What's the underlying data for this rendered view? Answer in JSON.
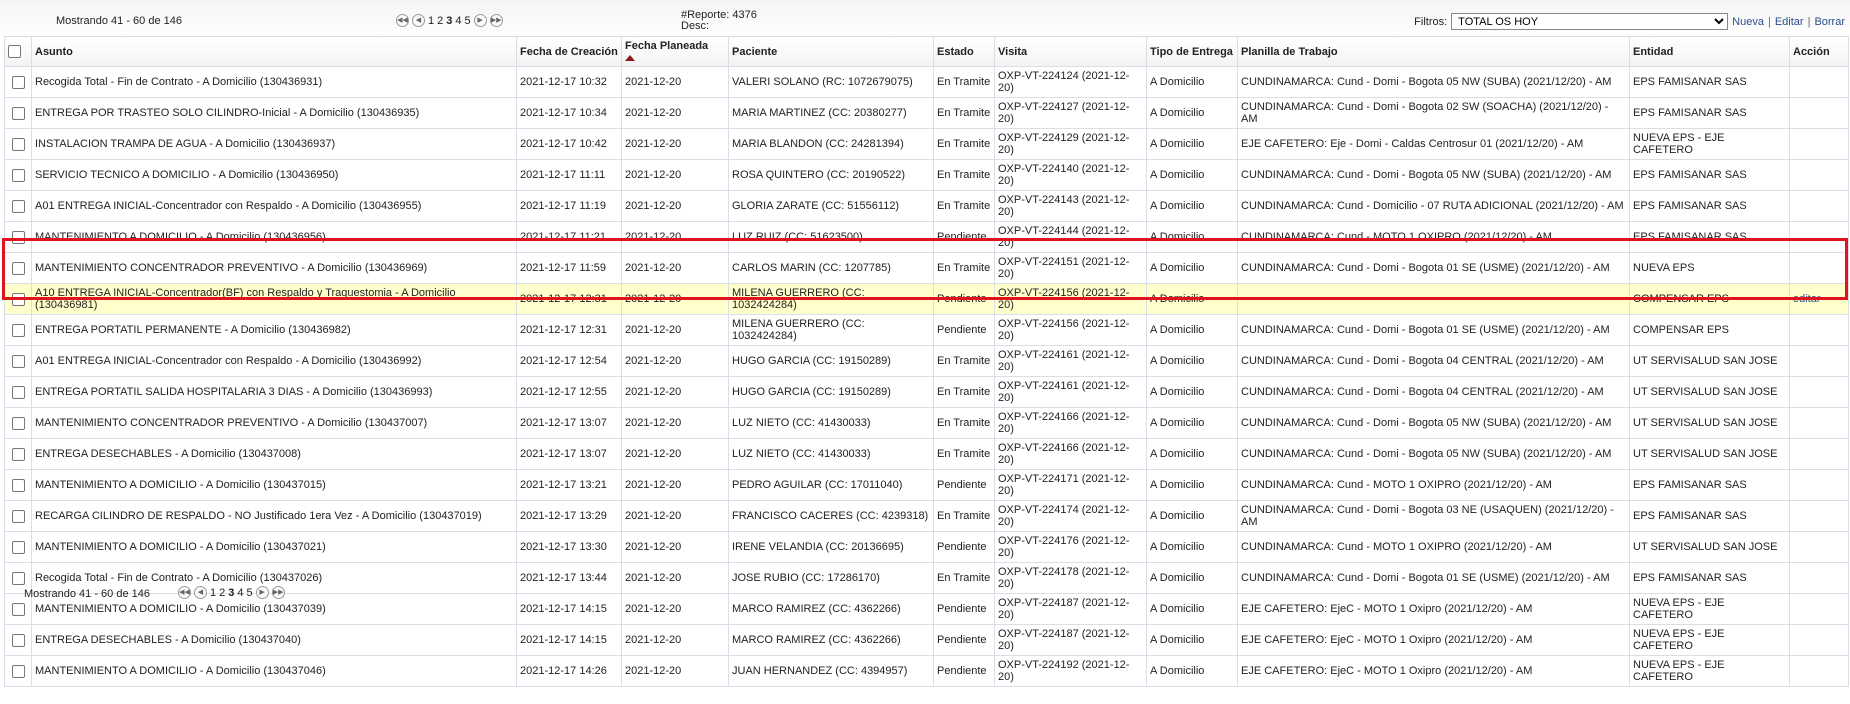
{
  "pager_top": {
    "showing": "Mostrando 41 - 60 de 146",
    "pages": [
      "1",
      "2",
      "3",
      "4",
      "5"
    ]
  },
  "report": {
    "number": "#Reporte: 4376",
    "desc": "Desc:"
  },
  "filters": {
    "label": "Filtros:",
    "selected": "TOTAL OS HOY",
    "links": [
      "Nueva",
      "Editar",
      "Borrar"
    ]
  },
  "table": {
    "headers": {
      "asunto": "Asunto",
      "fecha_creacion": "Fecha de Creación",
      "fecha_planeada": "Fecha Planeada",
      "paciente": "Paciente",
      "estado": "Estado",
      "visita": "Visita",
      "tipo_entrega": "Tipo de Entrega",
      "planilla": "Planilla de Trabajo",
      "entidad": "Entidad",
      "accion": "Acción"
    },
    "rows": [
      {
        "asunto": "Recogida Total - Fin de Contrato - A Domicilio (130436931)",
        "creacion": "2021-12-17 10:32",
        "planeada": "2021-12-20",
        "paciente": "VALERI SOLANO (RC: 1072679075)",
        "estado": "En Tramite",
        "visita": "OXP-VT-224124 (2021-12-20)",
        "tipo": "A Domicilio",
        "planilla": "CUNDINAMARCA: Cund - Domi - Bogota 05 NW (SUBA) (2021/12/20) - AM",
        "entidad": "EPS FAMISANAR SAS",
        "accion": ""
      },
      {
        "asunto": "ENTREGA POR TRASTEO SOLO CILINDRO-Inicial - A Domicilio (130436935)",
        "creacion": "2021-12-17 10:34",
        "planeada": "2021-12-20",
        "paciente": "MARIA MARTINEZ (CC: 20380277)",
        "estado": "En Tramite",
        "visita": "OXP-VT-224127 (2021-12-20)",
        "tipo": "A Domicilio",
        "planilla": "CUNDINAMARCA: Cund - Domi - Bogota 02 SW (SOACHA) (2021/12/20) - AM",
        "entidad": "EPS FAMISANAR SAS",
        "accion": ""
      },
      {
        "asunto": "INSTALACION TRAMPA DE AGUA - A Domicilio (130436937)",
        "creacion": "2021-12-17 10:42",
        "planeada": "2021-12-20",
        "paciente": "MARIA BLANDON (CC: 24281394)",
        "estado": "En Tramite",
        "visita": "OXP-VT-224129 (2021-12-20)",
        "tipo": "A Domicilio",
        "planilla": "EJE CAFETERO: Eje - Domi - Caldas Centrosur 01 (2021/12/20) - AM",
        "entidad": "NUEVA EPS - EJE CAFETERO",
        "accion": ""
      },
      {
        "asunto": "SERVICIO TECNICO A DOMICILIO - A Domicilio (130436950)",
        "creacion": "2021-12-17 11:11",
        "planeada": "2021-12-20",
        "paciente": "ROSA QUINTERO (CC: 20190522)",
        "estado": "En Tramite",
        "visita": "OXP-VT-224140 (2021-12-20)",
        "tipo": "A Domicilio",
        "planilla": "CUNDINAMARCA: Cund - Domi - Bogota 05 NW (SUBA) (2021/12/20) - AM",
        "entidad": "EPS FAMISANAR SAS",
        "accion": ""
      },
      {
        "asunto": "A01 ENTREGA INICIAL-Concentrador con Respaldo - A Domicilio (130436955)",
        "creacion": "2021-12-17 11:19",
        "planeada": "2021-12-20",
        "paciente": "GLORIA ZARATE (CC: 51556112)",
        "estado": "En Tramite",
        "visita": "OXP-VT-224143 (2021-12-20)",
        "tipo": "A Domicilio",
        "planilla": "CUNDINAMARCA: Cund - Domicilio - 07 RUTA ADICIONAL (2021/12/20) - AM",
        "entidad": "EPS FAMISANAR SAS",
        "accion": ""
      },
      {
        "asunto": "MANTENIMIENTO A DOMICILIO - A Domicilio (130436956)",
        "creacion": "2021-12-17 11:21",
        "planeada": "2021-12-20",
        "paciente": "LUZ RUIZ (CC: 51623500)",
        "estado": "Pendiente",
        "visita": "OXP-VT-224144 (2021-12-20)",
        "tipo": "A Domicilio",
        "planilla": "CUNDINAMARCA: Cund - MOTO 1 OXIPRO (2021/12/20) - AM",
        "entidad": "EPS FAMISANAR SAS",
        "accion": ""
      },
      {
        "asunto": "MANTENIMIENTO CONCENTRADOR PREVENTIVO - A Domicilio (130436969)",
        "creacion": "2021-12-17 11:59",
        "planeada": "2021-12-20",
        "paciente": "CARLOS MARIN (CC: 1207785)",
        "estado": "En Tramite",
        "visita": "OXP-VT-224151 (2021-12-20)",
        "tipo": "A Domicilio",
        "planilla": "CUNDINAMARCA: Cund - Domi - Bogota 01 SE (USME) (2021/12/20) - AM",
        "entidad": "NUEVA EPS",
        "accion": ""
      },
      {
        "asunto": "A10 ENTREGA INICIAL-Concentrador(BF) con Respaldo y Traquestomia - A Domicilio (130436981)",
        "creacion": "2021-12-17 12:31",
        "planeada": "2021-12-20",
        "paciente": "MILENA GUERRERO (CC: 1032424284)",
        "estado": "Pendiente",
        "visita": "OXP-VT-224156 (2021-12-20)",
        "tipo": "A Domicilio",
        "planilla": "",
        "entidad": "COMPENSAR EPS",
        "accion": "editar",
        "highlight": true
      },
      {
        "asunto": "ENTREGA PORTATIL PERMANENTE - A Domicilio (130436982)",
        "creacion": "2021-12-17 12:31",
        "planeada": "2021-12-20",
        "paciente": "MILENA GUERRERO (CC: 1032424284)",
        "estado": "Pendiente",
        "visita": "OXP-VT-224156 (2021-12-20)",
        "tipo": "A Domicilio",
        "planilla": "CUNDINAMARCA: Cund - Domi - Bogota 01 SE (USME) (2021/12/20) - AM",
        "entidad": "COMPENSAR EPS",
        "accion": ""
      },
      {
        "asunto": "A01 ENTREGA INICIAL-Concentrador con Respaldo - A Domicilio (130436992)",
        "creacion": "2021-12-17 12:54",
        "planeada": "2021-12-20",
        "paciente": "HUGO GARCIA (CC: 19150289)",
        "estado": "En Tramite",
        "visita": "OXP-VT-224161 (2021-12-20)",
        "tipo": "A Domicilio",
        "planilla": "CUNDINAMARCA: Cund - Domi - Bogota 04 CENTRAL (2021/12/20) - AM",
        "entidad": "UT SERVISALUD SAN JOSE",
        "accion": ""
      },
      {
        "asunto": "ENTREGA PORTATIL SALIDA HOSPITALARIA 3 DIAS - A Domicilio (130436993)",
        "creacion": "2021-12-17 12:55",
        "planeada": "2021-12-20",
        "paciente": "HUGO GARCIA (CC: 19150289)",
        "estado": "En Tramite",
        "visita": "OXP-VT-224161 (2021-12-20)",
        "tipo": "A Domicilio",
        "planilla": "CUNDINAMARCA: Cund - Domi - Bogota 04 CENTRAL (2021/12/20) - AM",
        "entidad": "UT SERVISALUD SAN JOSE",
        "accion": ""
      },
      {
        "asunto": "MANTENIMIENTO CONCENTRADOR PREVENTIVO - A Domicilio (130437007)",
        "creacion": "2021-12-17 13:07",
        "planeada": "2021-12-20",
        "paciente": "LUZ NIETO (CC: 41430033)",
        "estado": "En Tramite",
        "visita": "OXP-VT-224166 (2021-12-20)",
        "tipo": "A Domicilio",
        "planilla": "CUNDINAMARCA: Cund - Domi - Bogota 05 NW (SUBA) (2021/12/20) - AM",
        "entidad": "UT SERVISALUD SAN JOSE",
        "accion": ""
      },
      {
        "asunto": "ENTREGA DESECHABLES - A Domicilio (130437008)",
        "creacion": "2021-12-17 13:07",
        "planeada": "2021-12-20",
        "paciente": "LUZ NIETO (CC: 41430033)",
        "estado": "En Tramite",
        "visita": "OXP-VT-224166 (2021-12-20)",
        "tipo": "A Domicilio",
        "planilla": "CUNDINAMARCA: Cund - Domi - Bogota 05 NW (SUBA) (2021/12/20) - AM",
        "entidad": "UT SERVISALUD SAN JOSE",
        "accion": ""
      },
      {
        "asunto": "MANTENIMIENTO A DOMICILIO - A Domicilio (130437015)",
        "creacion": "2021-12-17 13:21",
        "planeada": "2021-12-20",
        "paciente": "PEDRO AGUILAR (CC: 17011040)",
        "estado": "Pendiente",
        "visita": "OXP-VT-224171 (2021-12-20)",
        "tipo": "A Domicilio",
        "planilla": "CUNDINAMARCA: Cund - MOTO 1 OXIPRO (2021/12/20) - AM",
        "entidad": "EPS FAMISANAR SAS",
        "accion": ""
      },
      {
        "asunto": "RECARGA CILINDRO DE RESPALDO - NO Justificado 1era Vez - A Domicilio (130437019)",
        "creacion": "2021-12-17 13:29",
        "planeada": "2021-12-20",
        "paciente": "FRANCISCO CACERES (CC: 4239318)",
        "estado": "En Tramite",
        "visita": "OXP-VT-224174 (2021-12-20)",
        "tipo": "A Domicilio",
        "planilla": "CUNDINAMARCA: Cund - Domi - Bogota 03 NE (USAQUEN) (2021/12/20) - AM",
        "entidad": "EPS FAMISANAR SAS",
        "accion": ""
      },
      {
        "asunto": "MANTENIMIENTO A DOMICILIO - A Domicilio (130437021)",
        "creacion": "2021-12-17 13:30",
        "planeada": "2021-12-20",
        "paciente": "IRENE VELANDIA (CC: 20136695)",
        "estado": "Pendiente",
        "visita": "OXP-VT-224176 (2021-12-20)",
        "tipo": "A Domicilio",
        "planilla": "CUNDINAMARCA: Cund - MOTO 1 OXIPRO (2021/12/20) - AM",
        "entidad": "UT SERVISALUD SAN JOSE",
        "accion": ""
      },
      {
        "asunto": "Recogida Total - Fin de Contrato - A Domicilio (130437026)",
        "creacion": "2021-12-17 13:44",
        "planeada": "2021-12-20",
        "paciente": "JOSE RUBIO (CC: 17286170)",
        "estado": "En Tramite",
        "visita": "OXP-VT-224178 (2021-12-20)",
        "tipo": "A Domicilio",
        "planilla": "CUNDINAMARCA: Cund - Domi - Bogota 01 SE (USME) (2021/12/20) - AM",
        "entidad": "EPS FAMISANAR SAS",
        "accion": ""
      },
      {
        "asunto": "MANTENIMIENTO A DOMICILIO - A Domicilio (130437039)",
        "creacion": "2021-12-17 14:15",
        "planeada": "2021-12-20",
        "paciente": "MARCO RAMIREZ (CC: 4362266)",
        "estado": "Pendiente",
        "visita": "OXP-VT-224187 (2021-12-20)",
        "tipo": "A Domicilio",
        "planilla": "EJE CAFETERO: EjeC - MOTO 1 Oxipro (2021/12/20) - AM",
        "entidad": "NUEVA EPS - EJE CAFETERO",
        "accion": ""
      },
      {
        "asunto": "ENTREGA DESECHABLES - A Domicilio (130437040)",
        "creacion": "2021-12-17 14:15",
        "planeada": "2021-12-20",
        "paciente": "MARCO RAMIREZ (CC: 4362266)",
        "estado": "Pendiente",
        "visita": "OXP-VT-224187 (2021-12-20)",
        "tipo": "A Domicilio",
        "planilla": "EJE CAFETERO: EjeC - MOTO 1 Oxipro (2021/12/20) - AM",
        "entidad": "NUEVA EPS - EJE CAFETERO",
        "accion": ""
      },
      {
        "asunto": "MANTENIMIENTO A DOMICILIO - A Domicilio (130437046)",
        "creacion": "2021-12-17 14:26",
        "planeada": "2021-12-20",
        "paciente": "JUAN HERNANDEZ (CC: 4394957)",
        "estado": "Pendiente",
        "visita": "OXP-VT-224192 (2021-12-20)",
        "tipo": "A Domicilio",
        "planilla": "EJE CAFETERO: EjeC - MOTO 1 Oxipro (2021/12/20) - AM",
        "entidad": "NUEVA EPS - EJE CAFETERO",
        "accion": ""
      }
    ]
  },
  "pager_bottom": {
    "showing": "Mostrando 41 - 60 de 146",
    "pages": [
      "1",
      "2",
      "3",
      "4",
      "5"
    ]
  },
  "colors": {
    "highlight_row": "#ffffcc",
    "annotation_box": "#e0141e",
    "sort_arrow": "#8b1a1a"
  },
  "icons": {
    "pager": [
      "first-page-icon",
      "prev-page-icon",
      "next-page-icon",
      "last-page-icon"
    ]
  }
}
